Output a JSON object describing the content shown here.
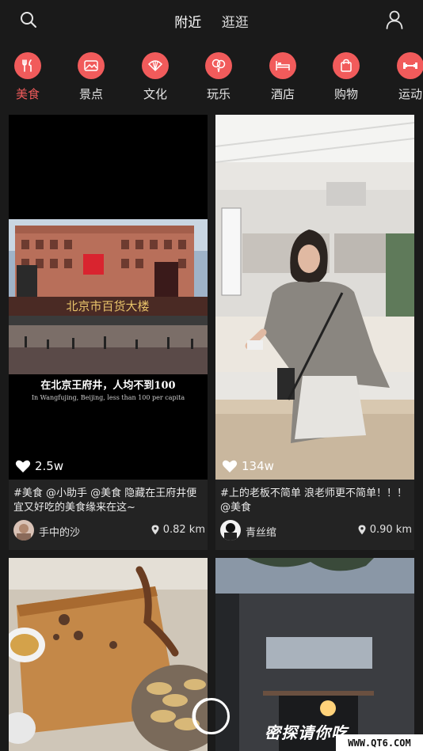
{
  "header": {
    "tabs": [
      "附近",
      "逛逛"
    ],
    "active_tab": 0,
    "search_icon": "search-icon",
    "user_icon": "user-icon"
  },
  "categories": [
    {
      "label": "美食",
      "icon": "fork-knife-icon",
      "active": true
    },
    {
      "label": "景点",
      "icon": "landscape-icon",
      "active": false
    },
    {
      "label": "文化",
      "icon": "fan-icon",
      "active": false
    },
    {
      "label": "玩乐",
      "icon": "balloon-icon",
      "active": false
    },
    {
      "label": "酒店",
      "icon": "bed-icon",
      "active": false
    },
    {
      "label": "购物",
      "icon": "shopping-bag-icon",
      "active": false
    },
    {
      "label": "运动",
      "icon": "dumbbell-icon",
      "active": false
    }
  ],
  "cards": [
    {
      "likes": "2.5w",
      "caption": "#美食 @小助手 @美食 隐藏在王府井便宜又好吃的美食缘来在这~",
      "username": "手中的沙",
      "distance": "0.82 km",
      "image_text_cn": "在北京王府井，人均不到100",
      "image_text_en": "In Wangfujing, Beijing, less than 100 per capita",
      "building_sign": "北京市百货大楼"
    },
    {
      "likes": "134w",
      "caption": "#上的老板不简单 浪老师更不简单！！！@美食",
      "username": "青丝绾",
      "distance": "0.90 km"
    },
    {},
    {
      "image_text": "密探请你吃"
    }
  ],
  "watermark": "WWW.QT6.COM",
  "colors": {
    "accent": "#f15b5b",
    "background": "#1a1a1a",
    "card": "#232323"
  }
}
